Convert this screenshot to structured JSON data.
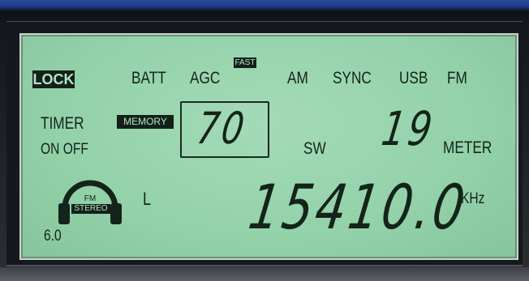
{
  "display": {
    "lock": "LOCK",
    "batt": "BATT",
    "agc": "AGC",
    "fast": "FAST",
    "am": "AM",
    "sync": "SYNC",
    "usb": "USB",
    "fm": "FM",
    "timer": "TIMER",
    "on_off": "ON OFF",
    "memory": "MEMORY",
    "memory_channel": "70",
    "sw": "SW",
    "meter_band": "19",
    "meter": "METER",
    "fm_stereo_top": "FM",
    "fm_stereo_bottom": "STEREO",
    "left_indicator": "L",
    "frequency": "15410.0",
    "unit": "KHz",
    "level": "6.0"
  },
  "colors": {
    "lcd_background": "#96d3ab",
    "segment": "#14241a",
    "bezel_blue": "#1f3c8c",
    "frame": "#15181d"
  },
  "icons": {
    "headphones": "headphones-icon"
  }
}
